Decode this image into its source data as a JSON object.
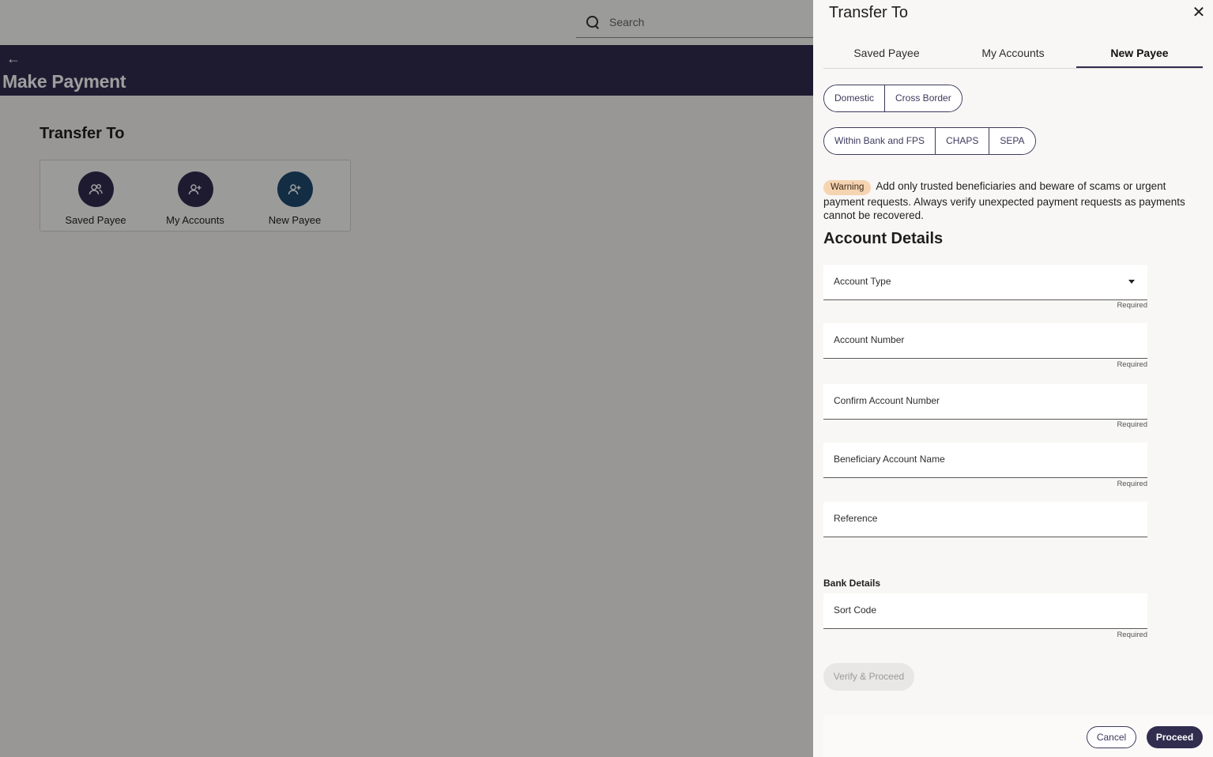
{
  "background": {
    "search": {
      "placeholder": "Search"
    },
    "back_label": "←",
    "page_title": "Make Payment",
    "section_title": "Transfer To",
    "options": [
      {
        "label": "Saved Payee"
      },
      {
        "label": "My Accounts"
      },
      {
        "label": "New Payee"
      }
    ]
  },
  "drawer": {
    "title": "Transfer To",
    "close_label": "✕",
    "tabs": [
      {
        "label": "Saved Payee"
      },
      {
        "label": "My Accounts"
      },
      {
        "label": "New Payee",
        "active": true
      }
    ],
    "region_options": [
      "Domestic",
      "Cross Border"
    ],
    "network_options": [
      "Within Bank and FPS",
      "CHAPS",
      "SEPA"
    ],
    "warning": {
      "badge": "Warning",
      "text": "Add only trusted beneficiaries and beware of scams or urgent payment requests. Always verify unexpected payment requests as payments cannot be recovered."
    },
    "account_details_title": "Account Details",
    "fields": {
      "account_type": {
        "label": "Account Type",
        "hint": "Required"
      },
      "account_number": {
        "label": "Account Number",
        "hint": "Required"
      },
      "confirm_account_number": {
        "label": "Confirm Account Number",
        "hint": "Required"
      },
      "beneficiary_name": {
        "label": "Beneficiary Account Name",
        "hint": "Required"
      },
      "reference": {
        "label": "Reference"
      },
      "sort_code": {
        "label": "Sort Code",
        "hint": "Required"
      }
    },
    "bank_details_title": "Bank Details",
    "verify_label": "Verify & Proceed",
    "cancel_label": "Cancel",
    "proceed_label": "Proceed"
  },
  "colors": {
    "brand": "#312d4f",
    "warning_badge": "#f6d4b1"
  }
}
